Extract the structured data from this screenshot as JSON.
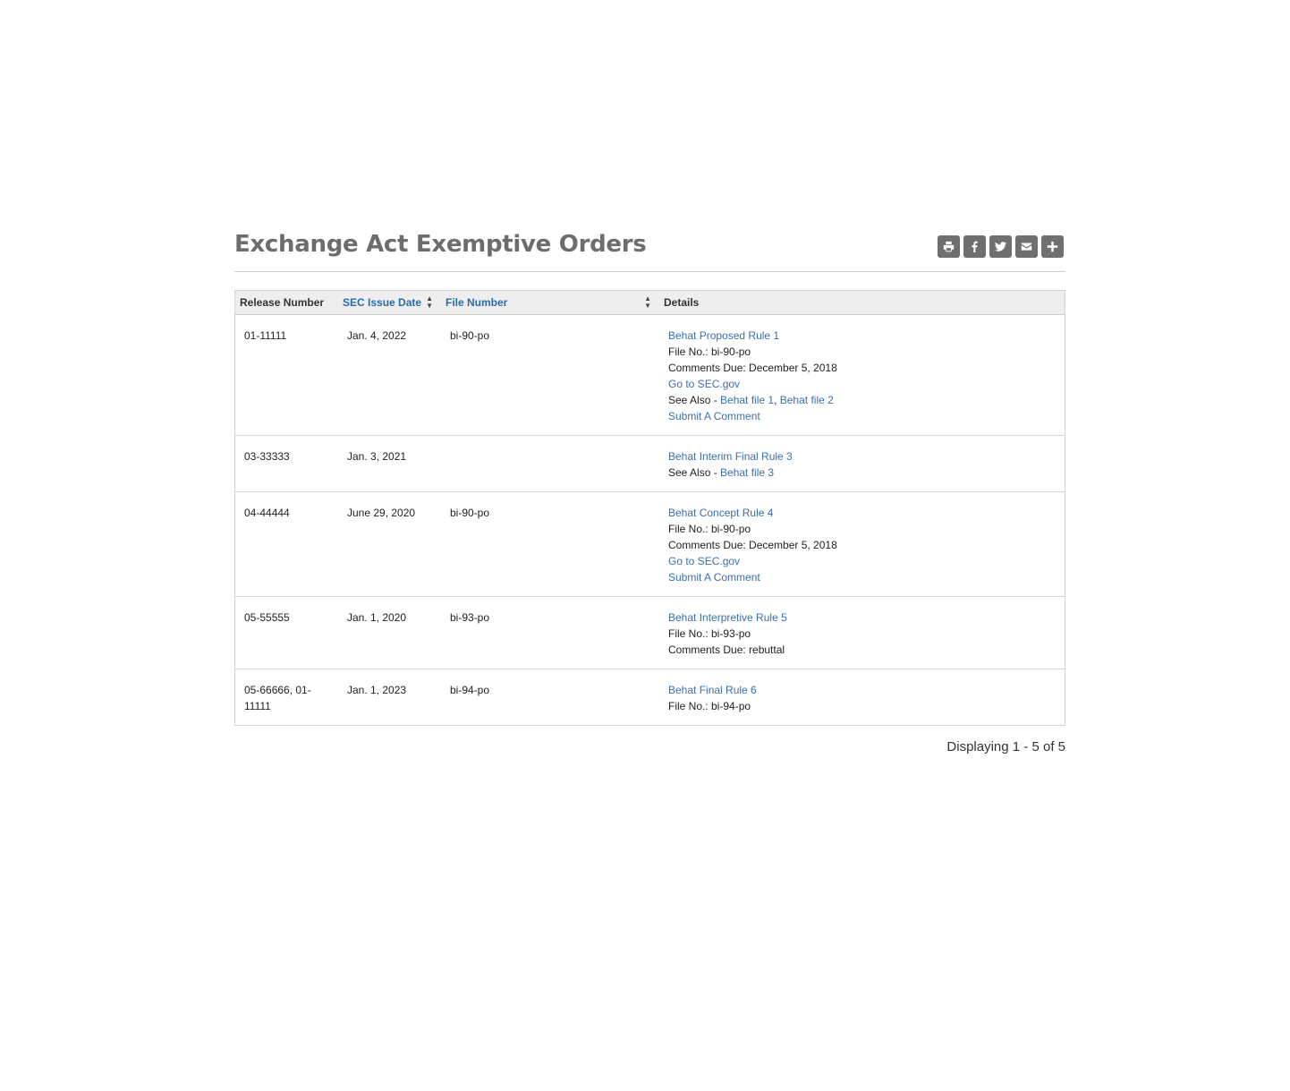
{
  "page": {
    "title": "Exchange Act Exemptive Orders",
    "share_icons": [
      "print-icon",
      "facebook-icon",
      "twitter-icon",
      "email-icon",
      "plus-icon"
    ]
  },
  "table": {
    "headers": {
      "release_number": "Release Number",
      "issue_date": "SEC Issue Date",
      "file_number": "File Number",
      "details": "Details"
    },
    "rows": [
      {
        "release": "01-11111",
        "date": "Jan. 4, 2022",
        "file": "bi-90-po",
        "title": "Behat Proposed Rule 1",
        "file_no": "File No.: bi-90-po",
        "comments_due": "Comments Due: December 5, 2018",
        "goto": "Go to SEC.gov",
        "see_also_prefix": "See Also - ",
        "see_also_1": "Behat file 1",
        "see_also_sep": ", ",
        "see_also_2": "Behat file 2",
        "submit": "Submit A Comment"
      },
      {
        "release": "03-33333",
        "date": "Jan. 3, 2021",
        "file": "",
        "title": "Behat Interim Final Rule 3",
        "see_also_prefix": "See Also - ",
        "see_also_1": "Behat file 3"
      },
      {
        "release": "04-44444",
        "date": "June 29, 2020",
        "file": "bi-90-po",
        "title": "Behat Concept Rule 4",
        "file_no": "File No.: bi-90-po",
        "comments_due": "Comments Due: December 5, 2018",
        "goto": "Go to SEC.gov",
        "submit": "Submit A Comment"
      },
      {
        "release": "05-55555",
        "date": "Jan. 1, 2020",
        "file": "bi-93-po",
        "title": "Behat Interpretive Rule 5",
        "file_no": "File No.: bi-93-po",
        "comments_due": "Comments Due: rebuttal"
      },
      {
        "release": "05-66666, 01-11111",
        "date": "Jan. 1, 2023",
        "file": "bi-94-po",
        "title": "Behat Final Rule 6",
        "file_no": "File No.: bi-94-po"
      }
    ]
  },
  "pager": {
    "text": "Displaying 1 - 5 of 5"
  },
  "colors": {
    "link": "#3b6fae",
    "title": "#6d6d6d",
    "button": "#6f6f6f",
    "header_bg": "#eeeeee"
  }
}
